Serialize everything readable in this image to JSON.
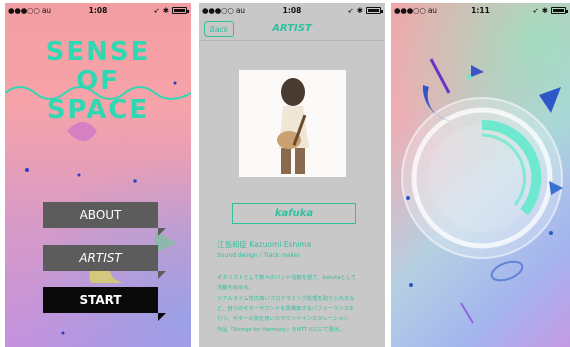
{
  "status_bars": [
    {
      "carrier": "●●●○○ au",
      "time": "1:08"
    },
    {
      "carrier": "●●●○○ au",
      "time": "1:08"
    },
    {
      "carrier": "●●●○○ au",
      "time": "1:11"
    }
  ],
  "home": {
    "logo_lines": [
      "SENSE",
      "OF",
      "SPACE"
    ],
    "menu": {
      "about": "ABOUT",
      "artist": "ARTIST",
      "start": "START"
    }
  },
  "artist_page": {
    "back_label": "Back",
    "title": "ARTIST",
    "name_box": "kafuka",
    "name_line": "江島和臣  Kazuomi Eshima",
    "role": "Sound design / Track maker",
    "bio_lines": [
      "ギタリストとして数々のバンド活動を経て、kafukaとして",
      "活動を始める。",
      "リアルタイム性の高いプログラミング処理を取り入れるな",
      "ど、自らのギターサウンドを再構築するパフォーマンスを",
      "行う。ギターの弦を用いたサウンドインスタレーション",
      "作品「Strings for Harmony」をNTT ICCにて展示。"
    ]
  },
  "colors": {
    "accent": "#31c09e",
    "button_dark": "#5c5c5c",
    "button_start": "#0a0a0a"
  },
  "icons": [
    "wifi-icon",
    "location-icon",
    "bluetooth-icon",
    "battery-icon"
  ]
}
